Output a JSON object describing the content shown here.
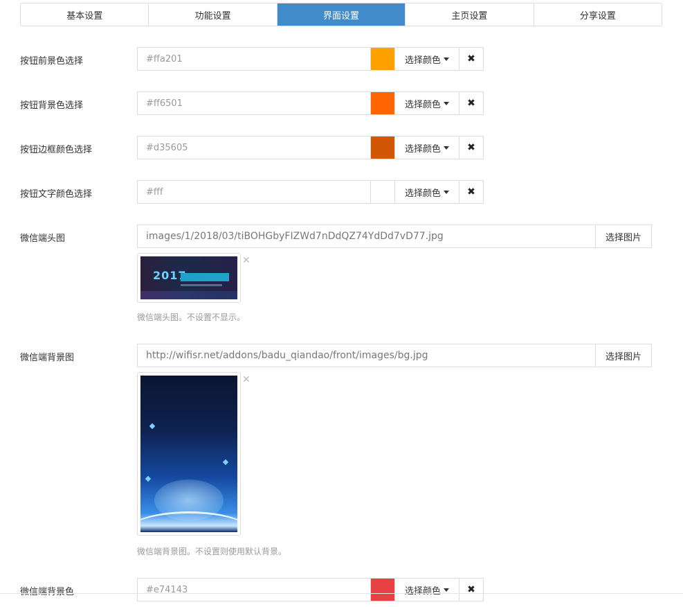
{
  "tabs": [
    {
      "label": "基本设置",
      "active": false
    },
    {
      "label": "功能设置",
      "active": false
    },
    {
      "label": "界面设置",
      "active": true
    },
    {
      "label": "主页设置",
      "active": false
    },
    {
      "label": "分享设置",
      "active": false
    }
  ],
  "common": {
    "pick_color_label": "选择颜色",
    "clear_icon": "✖",
    "pick_image_label": "选择图片",
    "remove_icon": "✕"
  },
  "colors": [
    {
      "label": "按钮前景色选择",
      "value": "#ffa201",
      "swatch": "#ffa201"
    },
    {
      "label": "按钮背景色选择",
      "value": "#ff6501",
      "swatch": "#ff6501"
    },
    {
      "label": "按钮边框颜色选择",
      "value": "#d35605",
      "swatch": "#d35605"
    },
    {
      "label": "按钮文字颜色选择",
      "value": "#fff",
      "swatch": "#ffffff"
    }
  ],
  "images": [
    {
      "label": "微信端头图",
      "value": "images/1/2018/03/tiBOHGbyFIZWd7nDdQZ74YdDd7vD77.jpg",
      "help": "微信端头图。不设置不显示。"
    },
    {
      "label": "微信端背景图",
      "value": "http://wifisr.net/addons/badu_qiandao/front/images/bg.jpg",
      "help": "微信端背景图。不设置则使用默认背景。"
    }
  ],
  "bg_color": {
    "label": "微信端背景色",
    "value": "#e74143",
    "swatch": "#e74143"
  },
  "banner_text": "2017"
}
